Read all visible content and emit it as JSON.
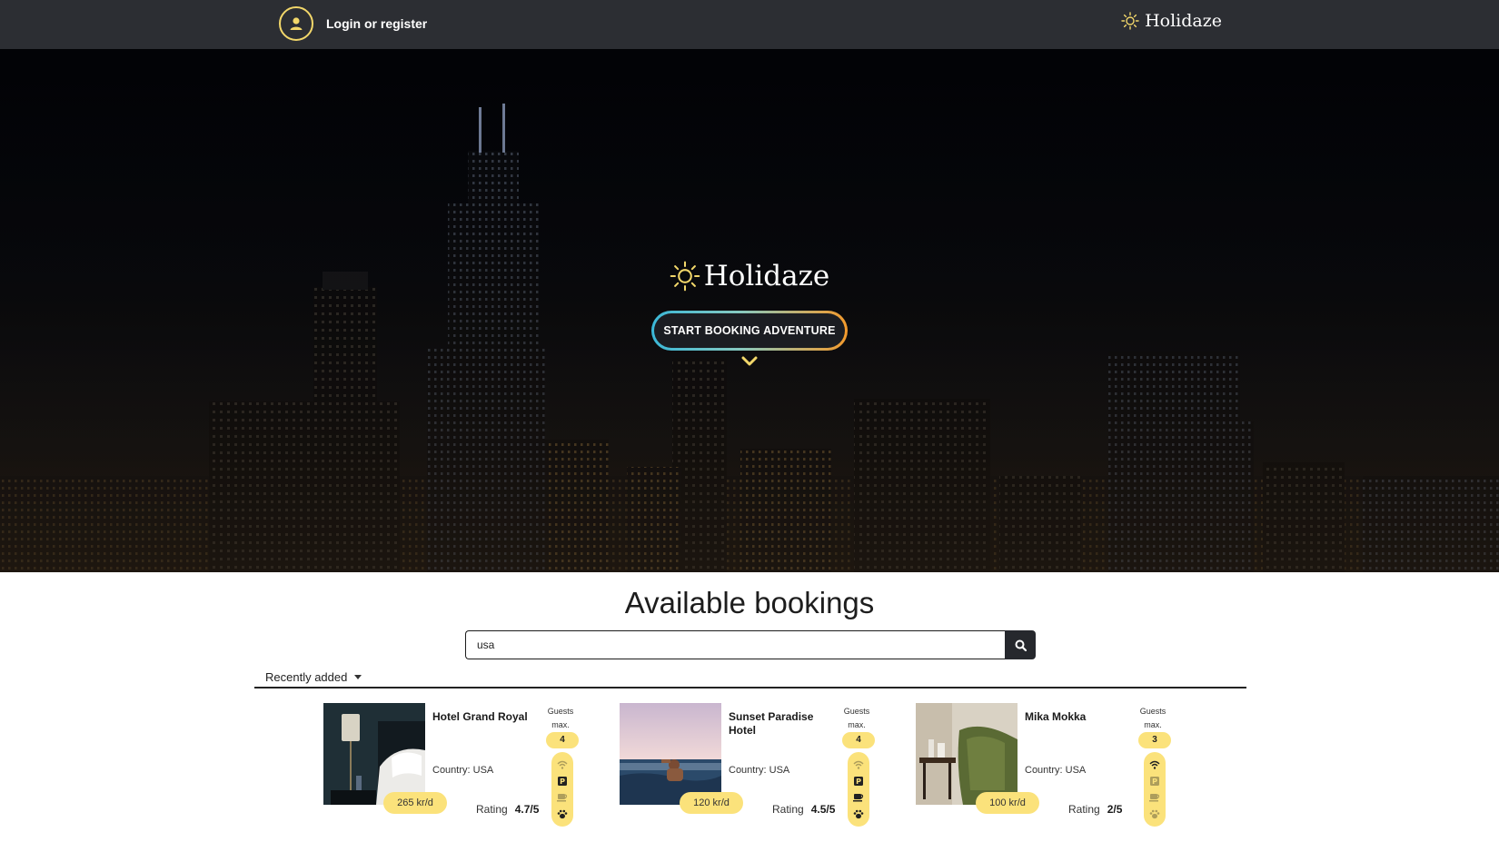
{
  "header": {
    "login_label": "Login or register",
    "brand": "Holidaze"
  },
  "hero": {
    "brand": "Holidaze",
    "cta_label": "START BOOKING ADVENTURE"
  },
  "colors": {
    "accent": "#fbe27b",
    "nav_bg": "#2c2e33",
    "cta_gradient_start": "#3ab8d8",
    "cta_gradient_end": "#f39a2c"
  },
  "bookings": {
    "title": "Available bookings",
    "search": {
      "value": "usa",
      "placeholder": ""
    },
    "sort_label": "Recently added",
    "cards": [
      {
        "name": "Hotel Grand Royal",
        "country": "Country: USA",
        "price": "265 kr/d",
        "rating_label": "Rating",
        "rating": "4.7/5",
        "guests_label": "Guests max.",
        "guests": "4",
        "amenities": {
          "wifi": false,
          "parking": true,
          "breakfast": false,
          "pets": true
        }
      },
      {
        "name": "Sunset Paradise Hotel",
        "country": "Country: USA",
        "price": "120 kr/d",
        "rating_label": "Rating",
        "rating": "4.5/5",
        "guests_label": "Guests max.",
        "guests": "4",
        "amenities": {
          "wifi": false,
          "parking": true,
          "breakfast": true,
          "pets": true
        }
      },
      {
        "name": "Mika Mokka",
        "country": "Country: USA",
        "price": "100 kr/d",
        "rating_label": "Rating",
        "rating": "2/5",
        "guests_label": "Guests max.",
        "guests": "3",
        "amenities": {
          "wifi": true,
          "parking": false,
          "breakfast": false,
          "pets": false
        }
      }
    ]
  }
}
